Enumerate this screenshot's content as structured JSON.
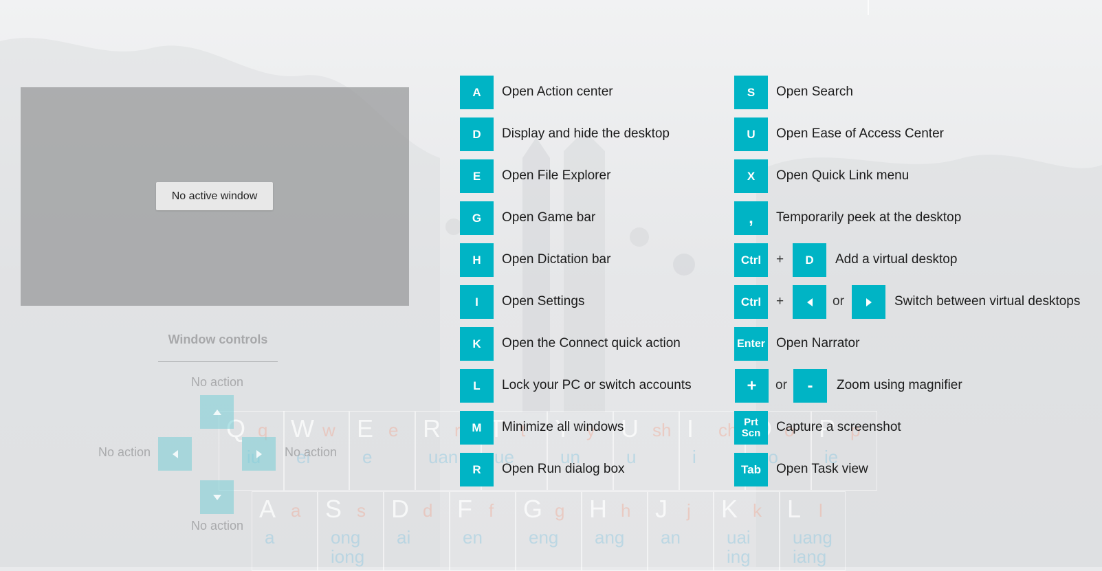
{
  "preview": {
    "message": "No active window"
  },
  "window_controls": {
    "title": "Window controls",
    "up_label": "No action",
    "left_label": "No action",
    "right_label": "No action",
    "down_label": "No action"
  },
  "keyboard_overlay": {
    "row1": [
      {
        "letter": "Q",
        "hint": "q",
        "py": "iu"
      },
      {
        "letter": "W",
        "hint": "w",
        "py": "ei"
      },
      {
        "letter": "E",
        "hint": "e",
        "py": "e"
      },
      {
        "letter": "R",
        "hint": "r",
        "py": "uan"
      },
      {
        "letter": "T",
        "hint": "t",
        "py": "ue"
      },
      {
        "letter": "Y",
        "hint": "y",
        "py": "un"
      },
      {
        "letter": "U",
        "hint": "sh",
        "py": "u"
      },
      {
        "letter": "I",
        "hint": "ch",
        "py": "i"
      },
      {
        "letter": "O",
        "hint": "o",
        "py": "uo"
      },
      {
        "letter": "P",
        "hint": "p",
        "py": "ie"
      }
    ],
    "row2": [
      {
        "letter": "A",
        "hint": "a",
        "py": "a"
      },
      {
        "letter": "S",
        "hint": "s",
        "py": "ong iong"
      },
      {
        "letter": "D",
        "hint": "d",
        "py": "ai"
      },
      {
        "letter": "F",
        "hint": "f",
        "py": "en"
      },
      {
        "letter": "G",
        "hint": "g",
        "py": "eng"
      },
      {
        "letter": "H",
        "hint": "h",
        "py": "ang"
      },
      {
        "letter": "J",
        "hint": "j",
        "py": "an"
      },
      {
        "letter": "K",
        "hint": "k",
        "py": "uai ing"
      },
      {
        "letter": "L",
        "hint": "l",
        "py": "uang iang"
      }
    ]
  },
  "shortcuts_left": [
    {
      "key": "A",
      "desc": "Open Action center"
    },
    {
      "key": "D",
      "desc": "Display and hide the desktop"
    },
    {
      "key": "E",
      "desc": "Open File Explorer"
    },
    {
      "key": "G",
      "desc": "Open Game bar"
    },
    {
      "key": "H",
      "desc": "Open Dictation bar"
    },
    {
      "key": "I",
      "desc": "Open Settings"
    },
    {
      "key": "K",
      "desc": "Open the Connect quick action"
    },
    {
      "key": "L",
      "desc": "Lock your PC or switch accounts"
    },
    {
      "key": "M",
      "desc": "Minimize all windows"
    },
    {
      "key": "R",
      "desc": "Open Run dialog box"
    }
  ],
  "shortcuts_right": {
    "s": {
      "key": "S",
      "desc": "Open Search"
    },
    "u": {
      "key": "U",
      "desc": "Open Ease of Access Center"
    },
    "x": {
      "key": "X",
      "desc": "Open Quick Link menu"
    },
    "comma": {
      "key": ",",
      "desc": "Temporarily peek at the desktop"
    },
    "ctrl_d": {
      "key1": "Ctrl",
      "plus": "+",
      "key2": "D",
      "desc": "Add a virtual desktop"
    },
    "ctrl_arrows": {
      "key1": "Ctrl",
      "plus": "+",
      "or": "or",
      "desc": "Switch between virtual desktops"
    },
    "enter": {
      "key": "Enter",
      "desc": "Open Narrator"
    },
    "zoom": {
      "key1": "+",
      "or": "or",
      "key2": "-",
      "desc": "Zoom using magnifier"
    },
    "prtscn": {
      "key": "Prt Scn",
      "desc": "Capture a screenshot"
    },
    "tab": {
      "key": "Tab",
      "desc": "Open Task view"
    }
  },
  "colors": {
    "key_accent": "#00b4c5",
    "background": "#e9eaec",
    "preview_overlay": "#969799"
  }
}
